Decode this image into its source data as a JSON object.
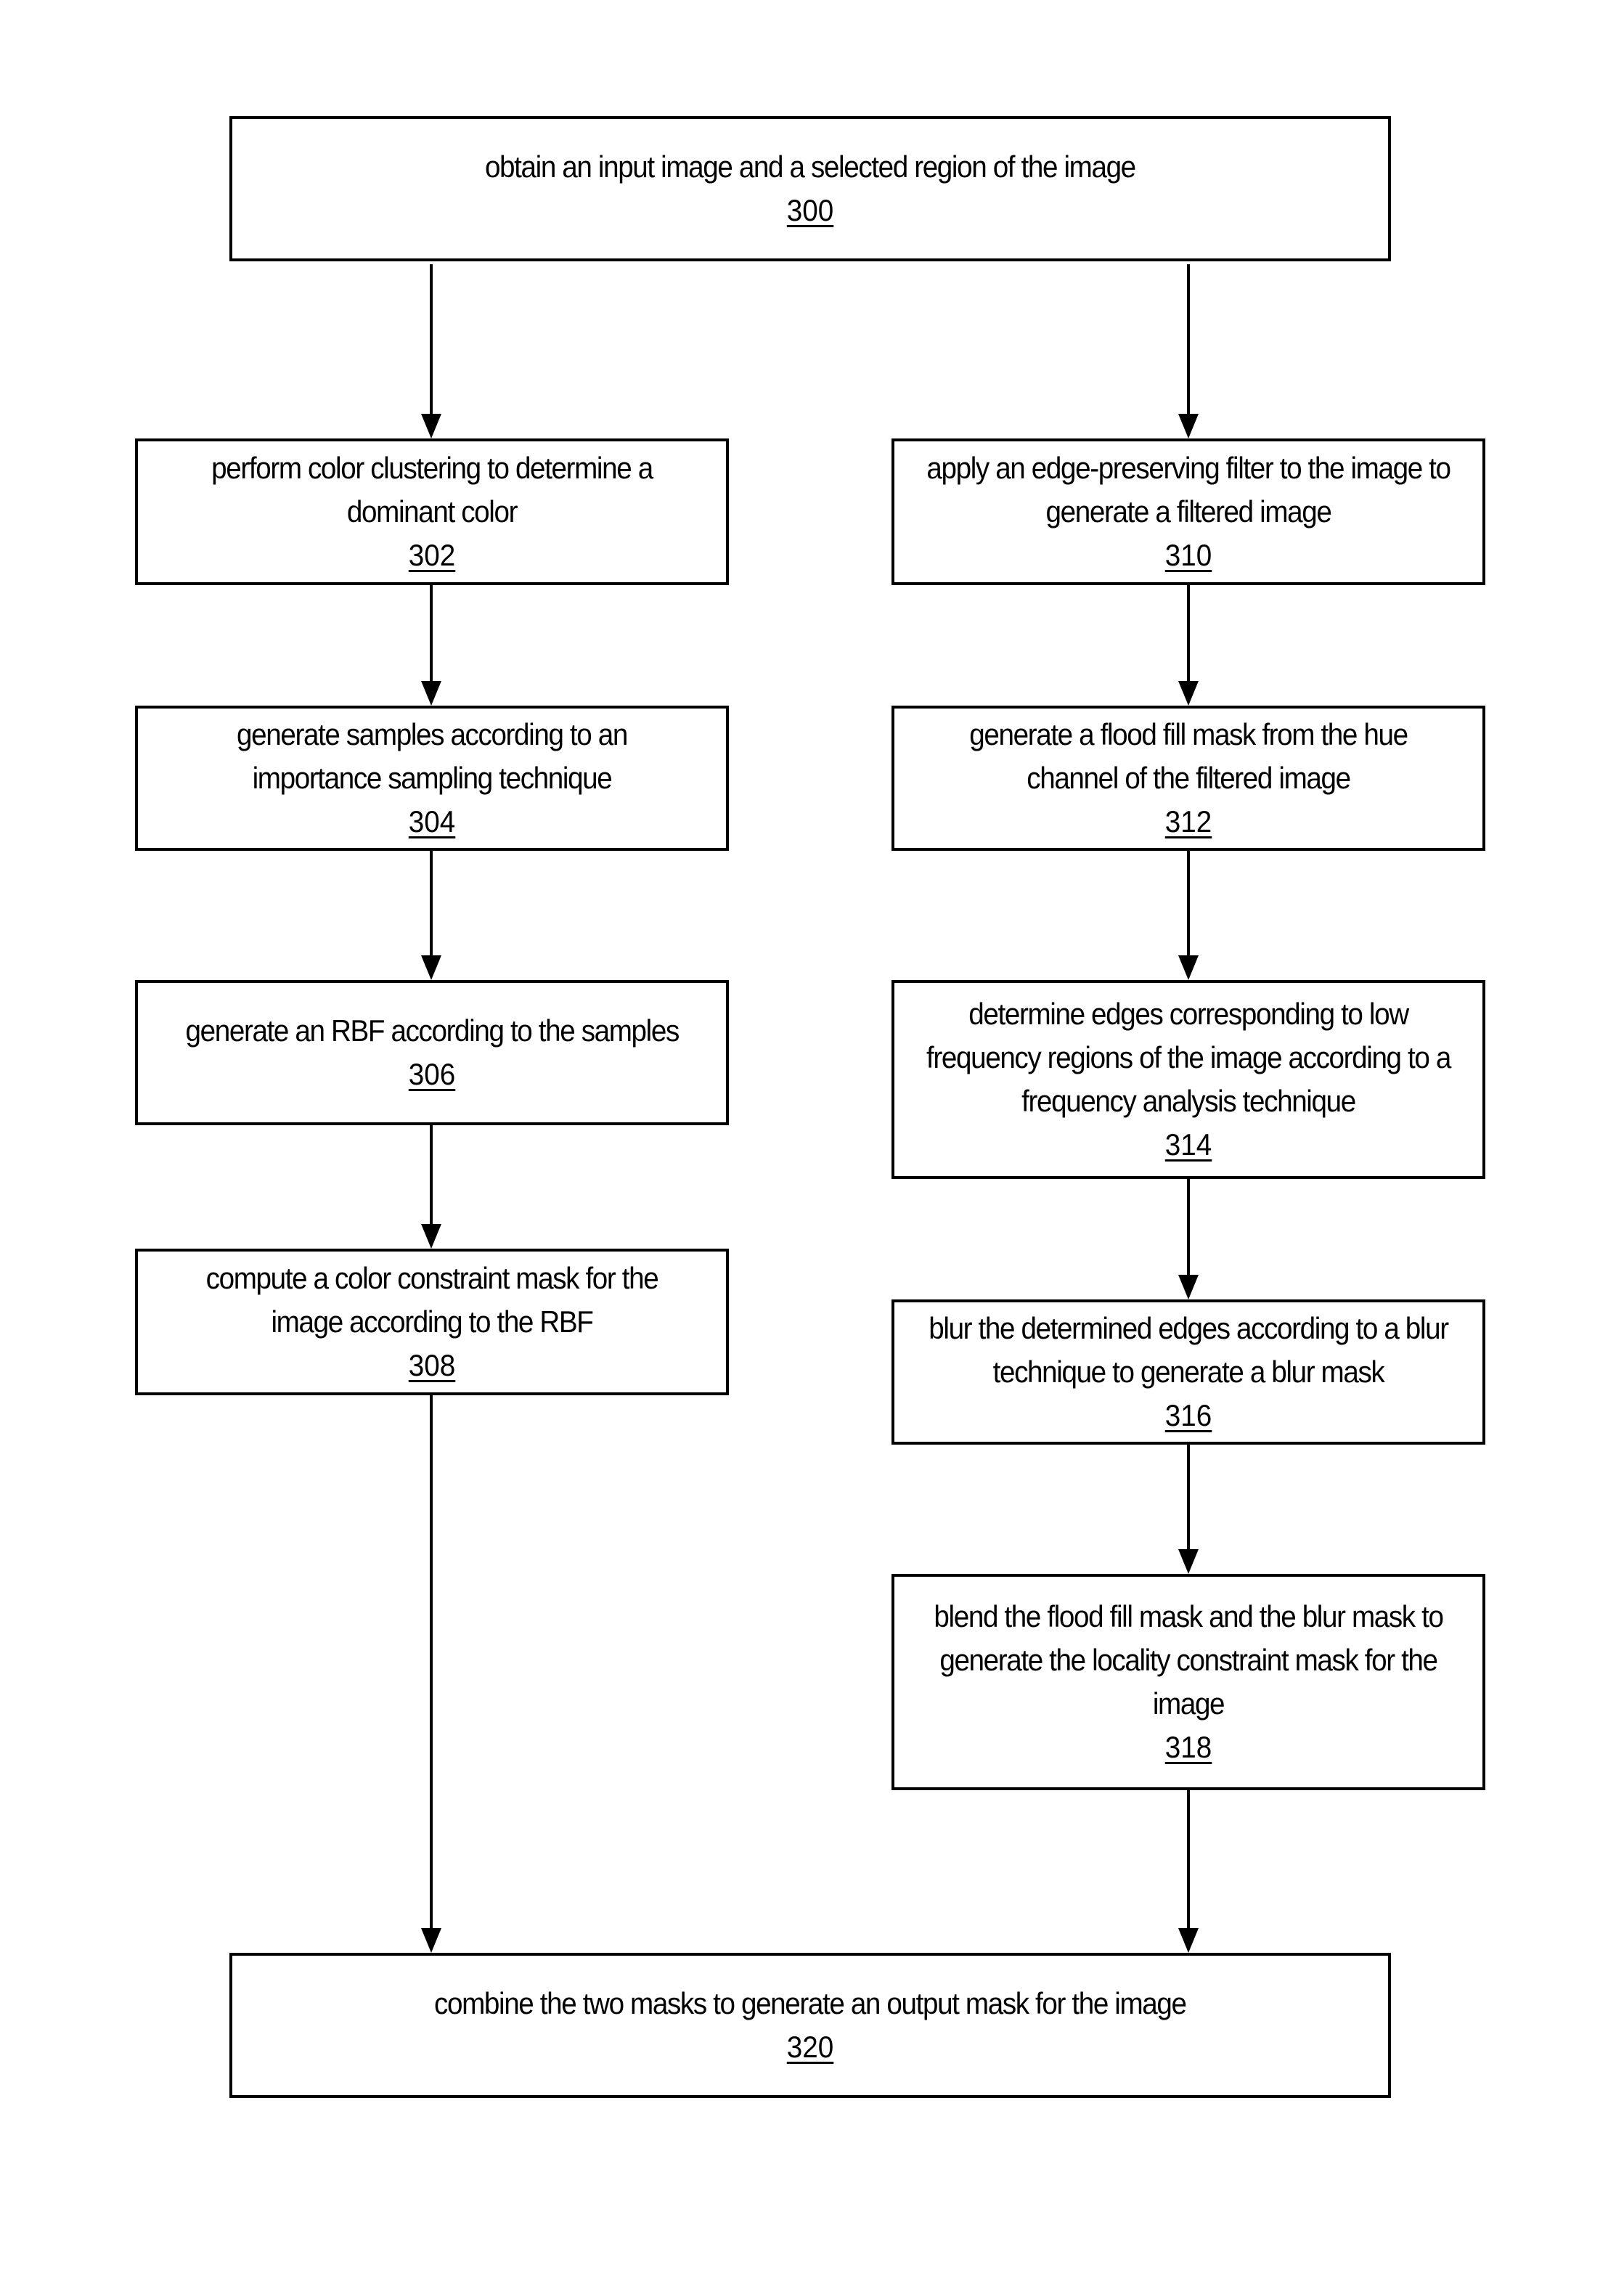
{
  "diagram": {
    "type": "flowchart",
    "colors": {
      "stroke": "#000000",
      "background": "#ffffff",
      "text": "#000000"
    },
    "steps": {
      "s300": {
        "text": "obtain an input image and a selected region of the image",
        "ref": "300"
      },
      "s302": {
        "text": "perform color clustering to determine a dominant color",
        "ref": "302"
      },
      "s304": {
        "text": "generate samples according to an importance sampling technique",
        "ref": "304"
      },
      "s306": {
        "text": "generate an RBF according to the samples",
        "ref": "306"
      },
      "s308": {
        "text": "compute a color constraint mask for the image according to the RBF",
        "ref": "308"
      },
      "s310": {
        "text": "apply  an edge-preserving filter to the image to generate a filtered image",
        "ref": "310"
      },
      "s312": {
        "text": "generate a flood fill mask from the hue channel of the filtered image",
        "ref": "312"
      },
      "s314": {
        "text": "determine edges corresponding to low frequency regions of the image according to a frequency analysis technique",
        "ref": "314"
      },
      "s316": {
        "text": "blur the determined  edges according to a blur technique to generate a blur mask",
        "ref": "316"
      },
      "s318": {
        "text": "blend the flood fill mask and the blur mask to generate the locality constraint mask for the image",
        "ref": "318"
      },
      "s320": {
        "text": "combine the two masks to generate an output mask for the image",
        "ref": "320"
      }
    },
    "edges": [
      {
        "from": "300",
        "to": "302"
      },
      {
        "from": "300",
        "to": "310"
      },
      {
        "from": "302",
        "to": "304"
      },
      {
        "from": "304",
        "to": "306"
      },
      {
        "from": "306",
        "to": "308"
      },
      {
        "from": "308",
        "to": "320"
      },
      {
        "from": "310",
        "to": "312"
      },
      {
        "from": "312",
        "to": "314"
      },
      {
        "from": "314",
        "to": "316"
      },
      {
        "from": "316",
        "to": "318"
      },
      {
        "from": "318",
        "to": "320"
      }
    ]
  }
}
